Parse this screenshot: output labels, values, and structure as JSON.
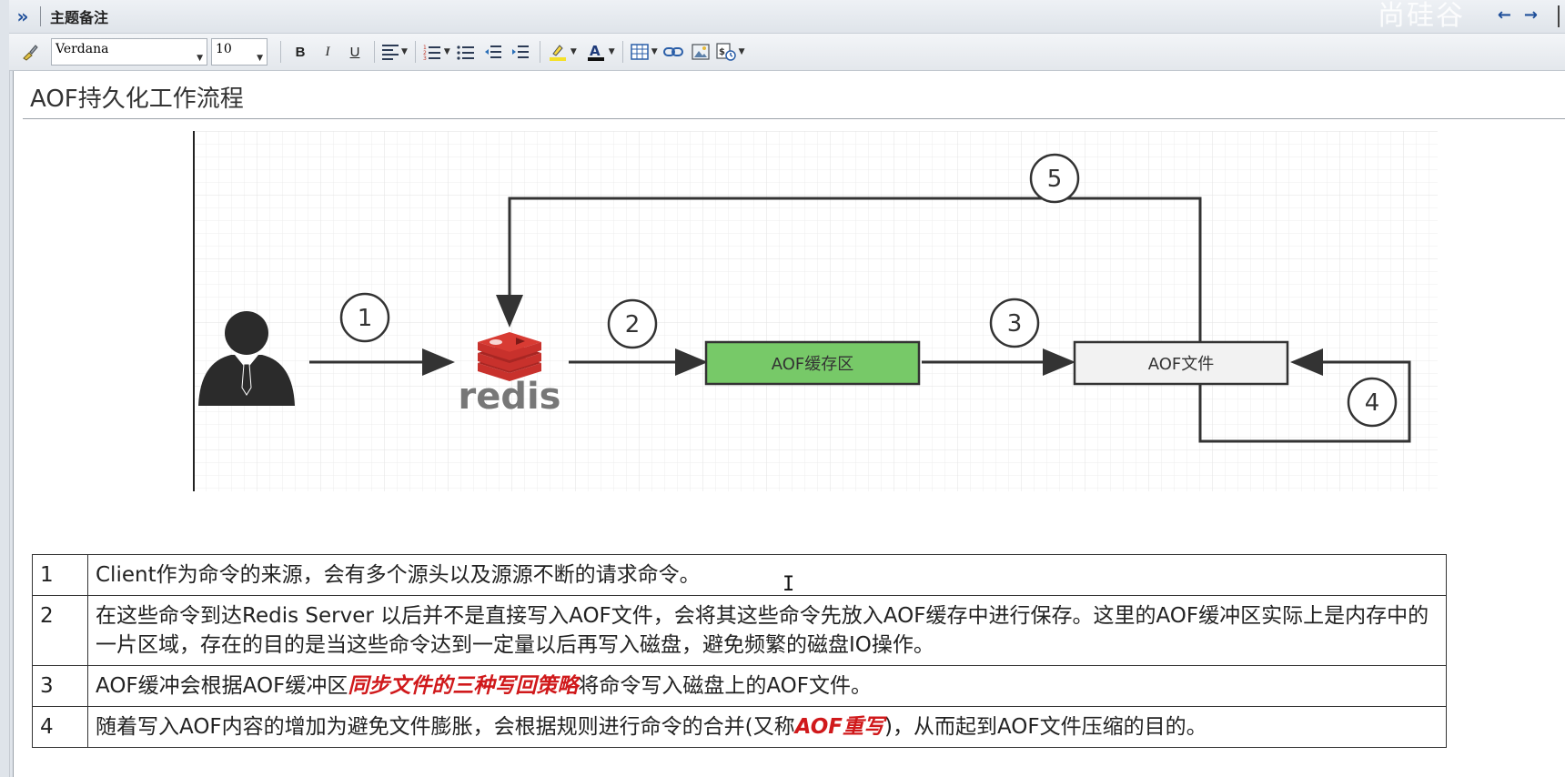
{
  "panel": {
    "title": "主题备注",
    "watermark": "尚硅谷"
  },
  "toolbar": {
    "font_family": "Verdana",
    "font_size": "10",
    "bold_label": "B",
    "italic_label": "I",
    "underline_label": "U"
  },
  "document": {
    "title": "AOF持久化工作流程"
  },
  "diagram": {
    "step_labels": [
      "1",
      "2",
      "3",
      "4",
      "5"
    ],
    "redis_label": "redis",
    "buffer_label": "AOF缓存区",
    "file_label": "AOF文件",
    "colors": {
      "buffer_fill": "#77c968",
      "file_fill": "#f2f2f2",
      "redis_red": "#c8312c",
      "redis_text": "#777777"
    }
  },
  "steps": [
    {
      "num": "1",
      "text": "Client作为命令的来源，会有多个源头以及源源不断的请求命令。"
    },
    {
      "num": "2",
      "text": "在这些命令到达Redis Server 以后并不是直接写入AOF文件，会将其这些命令先放入AOF缓存中进行保存。这里的AOF缓冲区实际上是内存中的一片区域，存在的目的是当这些命令达到一定量以后再写入磁盘，避免频繁的磁盘IO操作。"
    },
    {
      "num": "3",
      "pre": "AOF缓冲会根据AOF缓冲区",
      "highlight": "同步文件的三种写回策略",
      "post": "将命令写入磁盘上的AOF文件。"
    },
    {
      "num": "4",
      "pre": "随着写入AOF内容的增加为避免文件膨胀，会根据规则进行命令的合并(又称",
      "highlight": "AOF重写",
      "post": ")，从而起到AOF文件压缩的目的。"
    }
  ]
}
